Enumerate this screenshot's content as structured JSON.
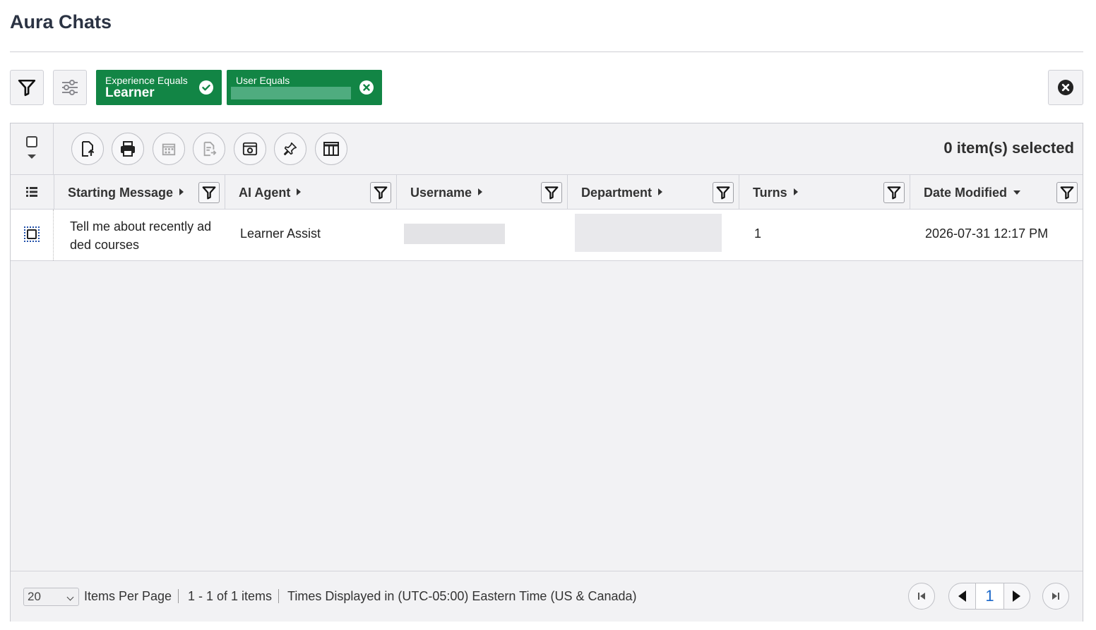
{
  "page": {
    "title": "Aura Chats"
  },
  "filters": {
    "chips": [
      {
        "label": "Experience Equals",
        "value": "Learner",
        "icon": "check-circle-icon"
      },
      {
        "label": "User Equals",
        "value": "",
        "icon": "close-circle-icon"
      }
    ]
  },
  "toolbar": {
    "selected_text": "0 item(s) selected",
    "buttons": [
      "export-icon",
      "print-icon",
      "calendar-icon",
      "report-icon",
      "settings-window-icon",
      "pin-icon",
      "columns-icon"
    ]
  },
  "table": {
    "columns": [
      {
        "label": "Starting Message",
        "sort": "none"
      },
      {
        "label": "AI Agent",
        "sort": "none"
      },
      {
        "label": "Username",
        "sort": "none"
      },
      {
        "label": "Department",
        "sort": "none"
      },
      {
        "label": "Turns",
        "sort": "none"
      },
      {
        "label": "Date Modified",
        "sort": "desc"
      }
    ],
    "rows": [
      {
        "starting_message": "Tell me about recently added courses",
        "ai_agent": "Learner Assist",
        "username": "",
        "department": "",
        "turns": "1",
        "date_modified": "2026-07-31 12:17 PM"
      }
    ]
  },
  "footer": {
    "page_size": "20",
    "items_per_page": "Items Per Page",
    "range": "1 - 1 of 1 items",
    "timezone": "Times Displayed in (UTC-05:00) Eastern Time (US & Canada)",
    "current_page": "1"
  },
  "colors": {
    "chip_green": "#128545",
    "page_link": "#1a67c9"
  }
}
